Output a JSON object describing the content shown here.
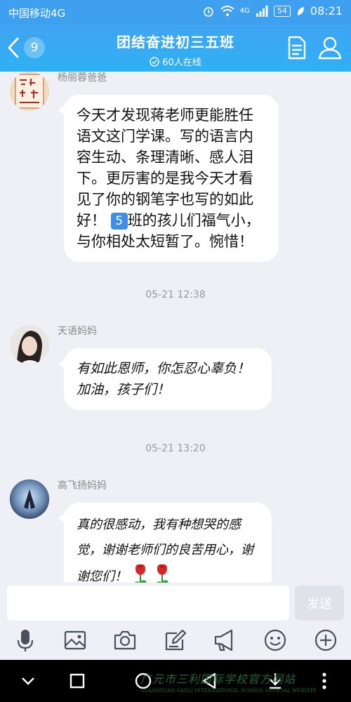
{
  "status_bar": {
    "carrier": "中国移动4G",
    "signal_label": "4G",
    "battery": "54",
    "time": "08:21"
  },
  "header": {
    "unread_count": "9",
    "title": "团结奋进初三五班",
    "online": "60人在线"
  },
  "messages": [
    {
      "sender": "杨丽蓉爸爸",
      "text_before": "今天才发现蒋老师更能胜任语文这门学课。写的语言内容生动、条理清晰、感人泪下。更厉害的是我今天才看见了你的钢笔字也写的如此好！",
      "emoji": "5",
      "text_after": "班的孩儿们福气小，与你相处太短暂了。惋惜！"
    },
    {
      "time": "05-21 12:38"
    },
    {
      "sender": "天语妈妈",
      "text": "有如此恩师，你怎忍心辜负！加油，孩子们！"
    },
    {
      "time": "05-21 13:20"
    },
    {
      "sender": "高飞扬妈妈",
      "text": "真的很感动，我有种想哭的感觉，谢谢老师们的良苦用心，谢谢您们！"
    }
  ],
  "input": {
    "placeholder": "",
    "send_label": "发送"
  },
  "watermark": {
    "text": "广元市三利国际学校官方网站",
    "sub": "GUANGYUAN SANLI INTERNATIONAL SCHOOL OFFICIAL WEBSITE"
  },
  "colors": {
    "header": "#3fa0f0",
    "background": "#eef0f5",
    "bubble": "#ffffff",
    "rose": "#d7262a"
  },
  "icons": [
    "back-icon",
    "group-doc-icon",
    "group-members-icon",
    "verified-icon",
    "mic-icon",
    "image-icon",
    "camera-icon",
    "edit-icon",
    "megaphone-icon",
    "emoji-icon",
    "plus-icon"
  ]
}
